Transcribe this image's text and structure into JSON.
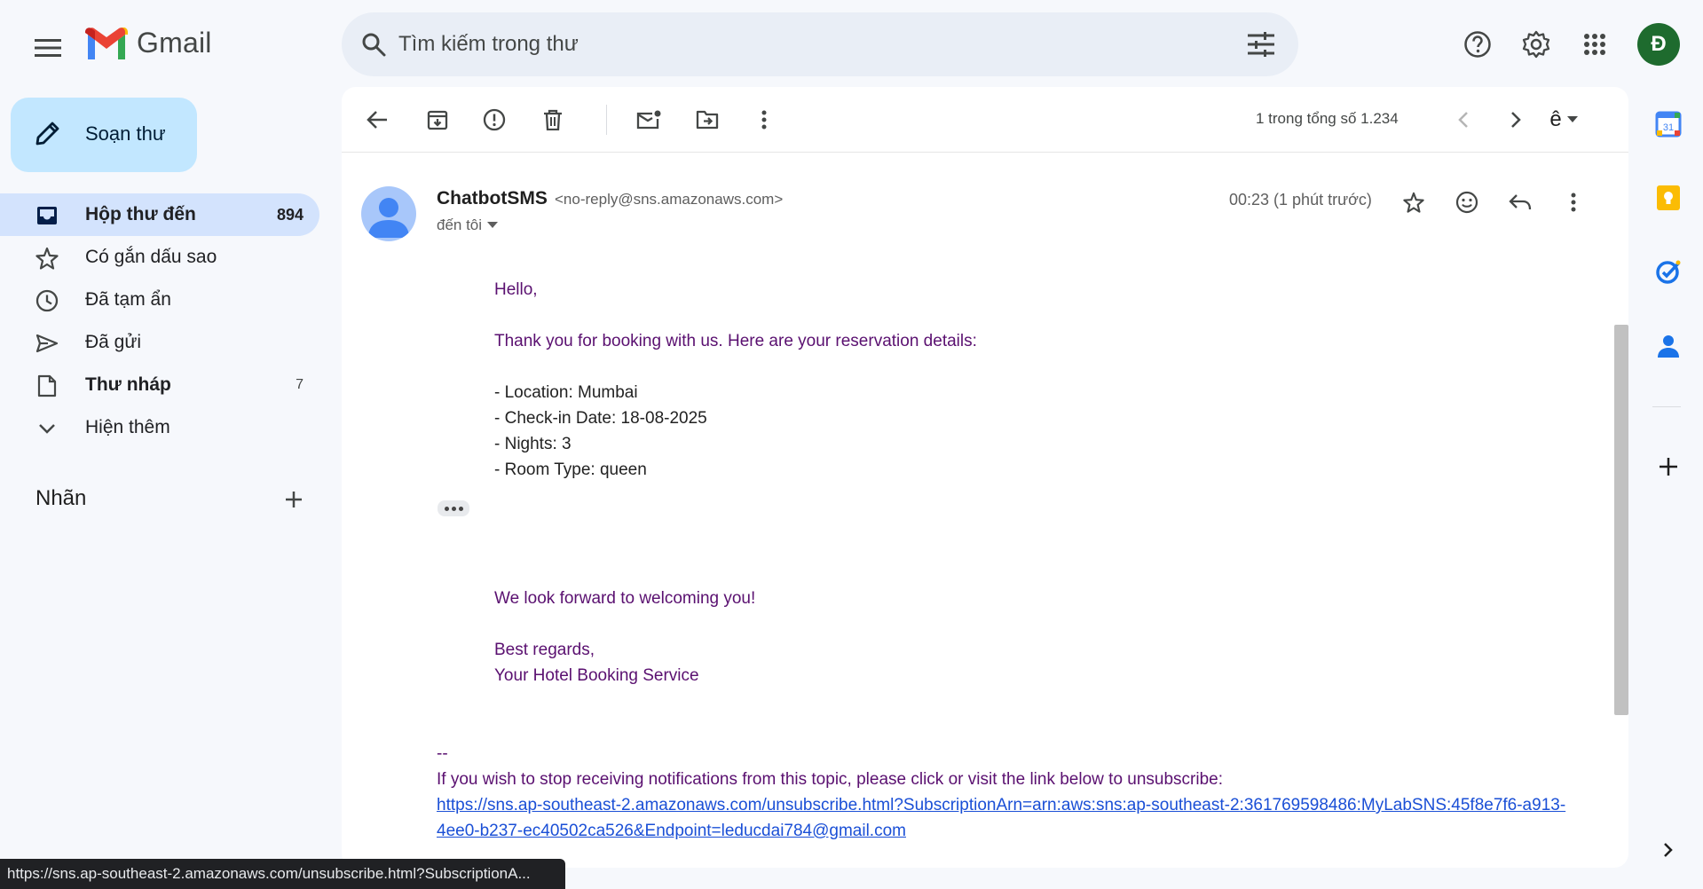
{
  "app": {
    "logo_text": "Gmail",
    "avatar_initial": "Đ"
  },
  "search": {
    "placeholder": "Tìm kiếm trong thư"
  },
  "compose": {
    "label": "Soạn thư"
  },
  "nav": {
    "items": [
      {
        "label": "Hộp thư đến",
        "count": "894",
        "icon": "inbox-icon"
      },
      {
        "label": "Có gắn dấu sao",
        "count": "",
        "icon": "star-icon"
      },
      {
        "label": "Đã tạm ẩn",
        "count": "",
        "icon": "clock-icon"
      },
      {
        "label": "Đã gửi",
        "count": "",
        "icon": "send-icon"
      },
      {
        "label": "Thư nháp",
        "count": "7",
        "icon": "draft-icon"
      },
      {
        "label": "Hiện thêm",
        "count": "",
        "icon": "chevron-down-icon"
      }
    ],
    "labels_heading": "Nhãn"
  },
  "toolbar": {
    "pager": "1 trong tổng số 1.234",
    "input_tool": "ê"
  },
  "message": {
    "sender_name": "ChatbotSMS",
    "sender_email": "<no-reply@sns.amazonaws.com>",
    "to": "đến tôi",
    "time": "00:23 (1 phút trước)",
    "greeting": "Hello,",
    "intro": "Thank you for booking with us. Here are your reservation details:",
    "details": [
      "- Location: Mumbai",
      "- Check-in Date: 18-08-2025",
      "- Nights: 3",
      "- Room Type: queen"
    ],
    "closing": "We look forward to welcoming you!",
    "regards": "Best regards,",
    "signature": "Your Hotel Booking Service",
    "sig_sep": "--",
    "unsubscribe_text": "If you wish to stop receiving notifications from this topic, please click or visit the link below to unsubscribe:",
    "unsubscribe_link": "https://sns.ap-southeast-2.amazonaws.com/unsubscribe.html?SubscriptionArn=arn:aws:sns:ap-southeast-2:361769598486:MyLabSNS:45f8e7f6-a913-4ee0-b237-ec40502ca526&Endpoint=leducdai784@gmail.com"
  },
  "status_bar": {
    "url": "https://sns.ap-southeast-2.amazonaws.com/unsubscribe.html?SubscriptionA..."
  },
  "side_panel": {
    "calendar_day": "31"
  },
  "colors": {
    "background": "#f6f8fc",
    "compose": "#c2e7ff",
    "active_nav": "#d3e3fd",
    "avatar": "#1e6b2e",
    "body_text": "#5a1070",
    "link": "#1a4fd6"
  }
}
